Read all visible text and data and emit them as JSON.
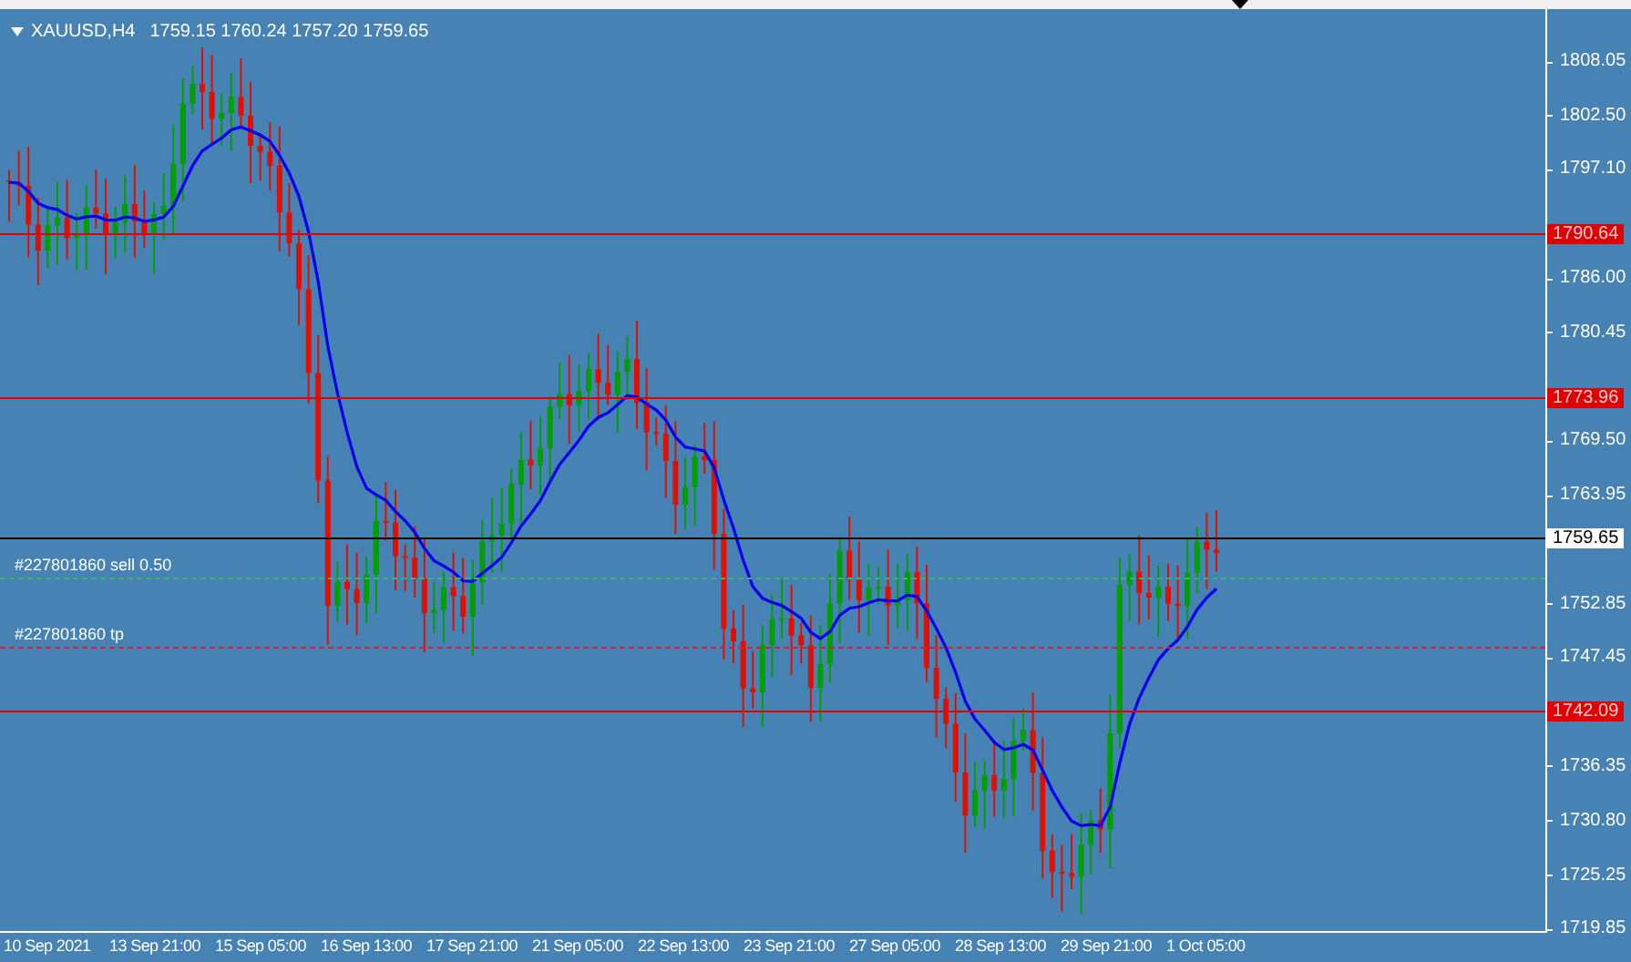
{
  "chart_header": {
    "symbol": "XAUUSD,H4",
    "ohlc": "1759.15 1760.24 1757.20 1759.65"
  },
  "levels": [
    {
      "kind": "line",
      "price": "1790.64"
    },
    {
      "kind": "line",
      "price": "1773.96"
    },
    {
      "kind": "current",
      "price": "1759.65"
    },
    {
      "kind": "line",
      "price": "1742.09"
    }
  ],
  "orders": [
    {
      "kind": "entry",
      "label": "#227801860 sell 0.50"
    },
    {
      "kind": "tp",
      "label": "#227801860 tp"
    }
  ],
  "price_axis": [
    "1808.05",
    "1802.50",
    "1797.10",
    "1786.00",
    "1780.45",
    "1769.50",
    "1763.95",
    "1752.85",
    "1747.45",
    "1736.35",
    "1730.80",
    "1725.25",
    "1719.85"
  ],
  "time_axis": [
    "10 Sep 2021",
    "13 Sep 21:00",
    "15 Sep 05:00",
    "16 Sep 13:00",
    "17 Sep 21:00",
    "21 Sep 05:00",
    "22 Sep 13:00",
    "23 Sep 21:00",
    "27 Sep 05:00",
    "28 Sep 13:00",
    "29 Sep 21:00",
    "1 Oct 05:00"
  ]
}
